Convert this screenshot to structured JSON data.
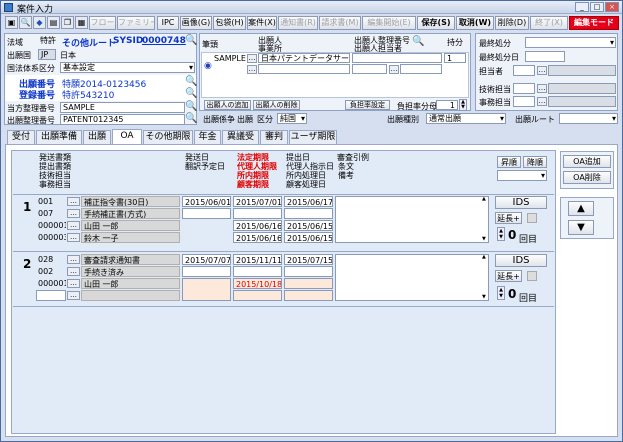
{
  "window": {
    "title": "案件入力"
  },
  "toolbar": {
    "buttons": [
      "フロー",
      "ファミリー(F)",
      "IPC",
      "画像(G)",
      "包袋(H)",
      "案件(X)",
      "通知書(R)",
      "請求書(M)",
      "編集開始(E)",
      "保存(S)",
      "取消(W)",
      "削除(D)",
      "終了(X)",
      "編集モード"
    ]
  },
  "header": {
    "hoho_label": "法域",
    "hoho_value": "特許",
    "category": "その他ルート",
    "sysid_label": "SYSID",
    "sysid": "0000748",
    "country_label": "出願国",
    "country_code": "JP",
    "country_name": "日本",
    "classification_label": "国法体系区分",
    "classification": "基本設定",
    "app_no_label": "出願番号",
    "app_no": "特願2014-0123456",
    "reg_no_label": "登録番号",
    "reg_no": "特許543210",
    "our_ref_label": "当方整理番号",
    "our_ref": "SAMPLE",
    "client_ref_label": "出願整理番号",
    "client_ref": "PATENT012345"
  },
  "applicants": {
    "section_label": "筆頭",
    "col1": "出願人",
    "col1b": "事業所",
    "col2": "出願人整理番号",
    "col2b": "出願人担当者",
    "col3": "持分",
    "name": "SAMPLE",
    "office": "日本パテントデータサービス株式",
    "share": "1",
    "add_btn": "出願人の追加",
    "del_btn": "出願人の削除",
    "burden_btn": "負担率設定",
    "burden_label": "負担率分母",
    "burden_value": "1"
  },
  "right": {
    "final_label": "最終処分",
    "final_date_label": "最終処分日",
    "person_label": "担当者",
    "tech_label": "技術担当",
    "office_label": "事務担当"
  },
  "mid": {
    "route_label": "出願係争",
    "route_value": "出願",
    "kubun_label": "区分",
    "kubun_value": "純国",
    "type_label": "出願種別",
    "type_value": "通常出願",
    "route2_label": "出願ルート"
  },
  "tabs": [
    "受付",
    "出願準備",
    "出願",
    "OA",
    "その他期限",
    "年金",
    "異議受",
    "審判",
    "ユーザ期限"
  ],
  "active_tab": "OA",
  "columns": {
    "c1": [
      "発送書類",
      "提出書類",
      "技術担当",
      "事務担当"
    ],
    "c2": [
      "発送日",
      "翻訳予定日"
    ],
    "c3": [
      "法定期限",
      "代理人期限",
      "所内期限",
      "顧客期限"
    ],
    "c4": [
      "提出日",
      "代理人指示日",
      "所内処理日",
      "顧客処理日"
    ],
    "c5": [
      "審査引例",
      "条文",
      "備考"
    ]
  },
  "side_buttons": {
    "up": "昇順",
    "down": "降順",
    "add": "OA追加",
    "del": "OA削除"
  },
  "records": [
    {
      "no": "1",
      "sent_code": "001",
      "sent_name": "補正指令書(30日)",
      "submit_code": "007",
      "submit_name": "手続補正書(方式)",
      "tech_code": "000001",
      "tech_name": "山田 一郎",
      "office_code": "000003",
      "office_name": "鈴木 一子",
      "sent_date": "2015/06/01",
      "legal": "2015/07/01",
      "submit_date": "2015/06/17",
      "agent": "2015/06/16",
      "agent_proc": "2015/06/15",
      "inhouse": "2015/06/16",
      "inhouse_proc": "2015/06/15",
      "ids": "IDS",
      "extend": "延長+",
      "count": "0",
      "count_suffix": "回目"
    },
    {
      "no": "2",
      "sent_code": "028",
      "sent_name": "審査請求通知書",
      "submit_code": "002",
      "submit_name": "手続き済み",
      "tech_code": "000001",
      "tech_name": "山田 一郎",
      "office_code": "",
      "office_name": "",
      "sent_date": "2015/07/07",
      "legal": "2015/11/11",
      "submit_date": "2015/07/15",
      "agent": "2015/10/18",
      "agent_proc": "",
      "inhouse": "",
      "inhouse_proc": "",
      "ids": "IDS",
      "extend": "延長+",
      "count": "0",
      "count_suffix": "回目"
    }
  ]
}
